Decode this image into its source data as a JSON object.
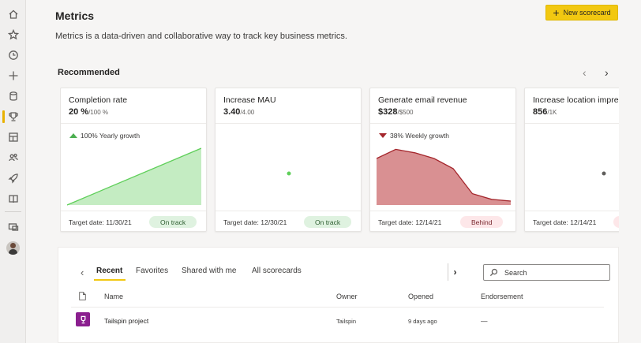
{
  "header": {
    "title": "Metrics",
    "description": "Metrics is a data-driven and collaborative way to track key business metrics.",
    "new_scorecard_label": "New scorecard"
  },
  "nav": {
    "items": [
      "home-icon",
      "star-icon",
      "clock-icon",
      "plus-icon",
      "database-icon",
      "trophy-icon",
      "dashboard-icon",
      "people-icon",
      "rocket-icon",
      "book-icon",
      "monitor-icon"
    ],
    "active": "trophy-icon",
    "accent": "#e8b100"
  },
  "recommended": {
    "title": "Recommended",
    "prev_arrow": "‹",
    "next_arrow": "›",
    "cards": [
      {
        "name": "Completion rate",
        "value": "20 %",
        "target": "/100 %",
        "growth": "100% Yearly growth",
        "trend": "up",
        "target_date": "Target date: 11/30/21",
        "status": "On track",
        "status_kind": "ontrack",
        "sparkline": [
          0,
          100
        ]
      },
      {
        "name": "Increase MAU",
        "value": "3.40",
        "target": "/4.00",
        "growth": "",
        "target_date": "Target date: 12/30/21",
        "status": "On track",
        "status_kind": "ontrack",
        "sparkline": [
          50
        ]
      },
      {
        "name": "Generate email revenue",
        "value": "$328",
        "target": "/$500",
        "growth": "38% Weekly growth",
        "trend": "down",
        "target_date": "Target date: 12/14/21",
        "status": "Behind",
        "status_kind": "behind",
        "sparkline": [
          82,
          98,
          92,
          82,
          64,
          20,
          10,
          7
        ]
      },
      {
        "name": "Increase location impre",
        "value": "856",
        "target": "/1K",
        "growth": "",
        "target_date": "Target date: 12/14/21",
        "status": "",
        "status_kind": "behind",
        "sparkline": [
          50
        ]
      }
    ],
    "colors": {
      "up_fill": "#c4ecc2",
      "up_line": "#5fcf5a",
      "down_fill": "#d99092",
      "down_line": "#a4262c",
      "dot": "#5fcf5a",
      "dot_grey": "#605e5c"
    }
  },
  "scorecards": {
    "back_arrow": "‹",
    "forward_arrow": "›",
    "tabs": [
      "Recent",
      "Favorites",
      "Shared with me",
      "All scorecards"
    ],
    "active_tab": "Recent",
    "search_placeholder": "Search",
    "columns": {
      "name": "Name",
      "owner": "Owner",
      "opened": "Opened",
      "endorsement": "Endorsement"
    },
    "rows": [
      {
        "name": "Tailspin project",
        "owner": "Tailspin",
        "opened": "9 days ago",
        "endorsement": "—"
      }
    ]
  }
}
